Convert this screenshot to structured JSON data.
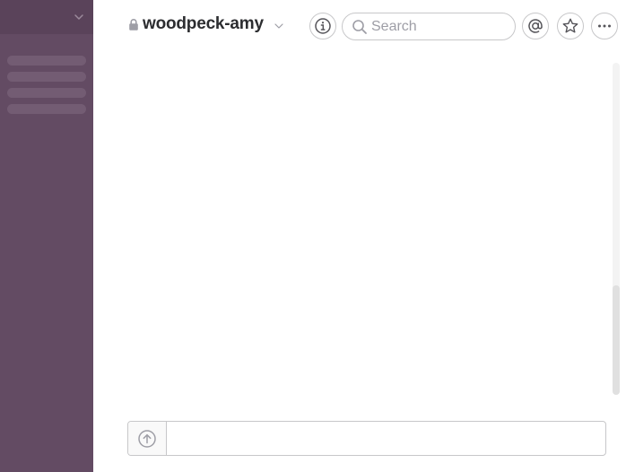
{
  "sidebar": {
    "icons": {
      "menu": "chevron-down-icon"
    },
    "colors": {
      "background": "#634b63",
      "header": "#5a435a",
      "skeleton": "#735c73"
    }
  },
  "header": {
    "channel_name": "woodpeck-amy",
    "icons": {
      "private": "lock-icon",
      "channel_menu": "chevron-down-icon",
      "info": "info-icon",
      "mentions": "at-sign-icon",
      "star": "star-icon",
      "more": "more-horizontal-icon"
    }
  },
  "search": {
    "placeholder": "Search",
    "value": "",
    "icon": "search-icon"
  },
  "composer": {
    "value": "",
    "placeholder": "",
    "icons": {
      "upload": "upload-arrow-icon"
    }
  },
  "colors": {
    "title_text": "#2c2d30",
    "border": "#c7c7c9",
    "placeholder": "#9e9ea6",
    "icon": "#555459"
  }
}
